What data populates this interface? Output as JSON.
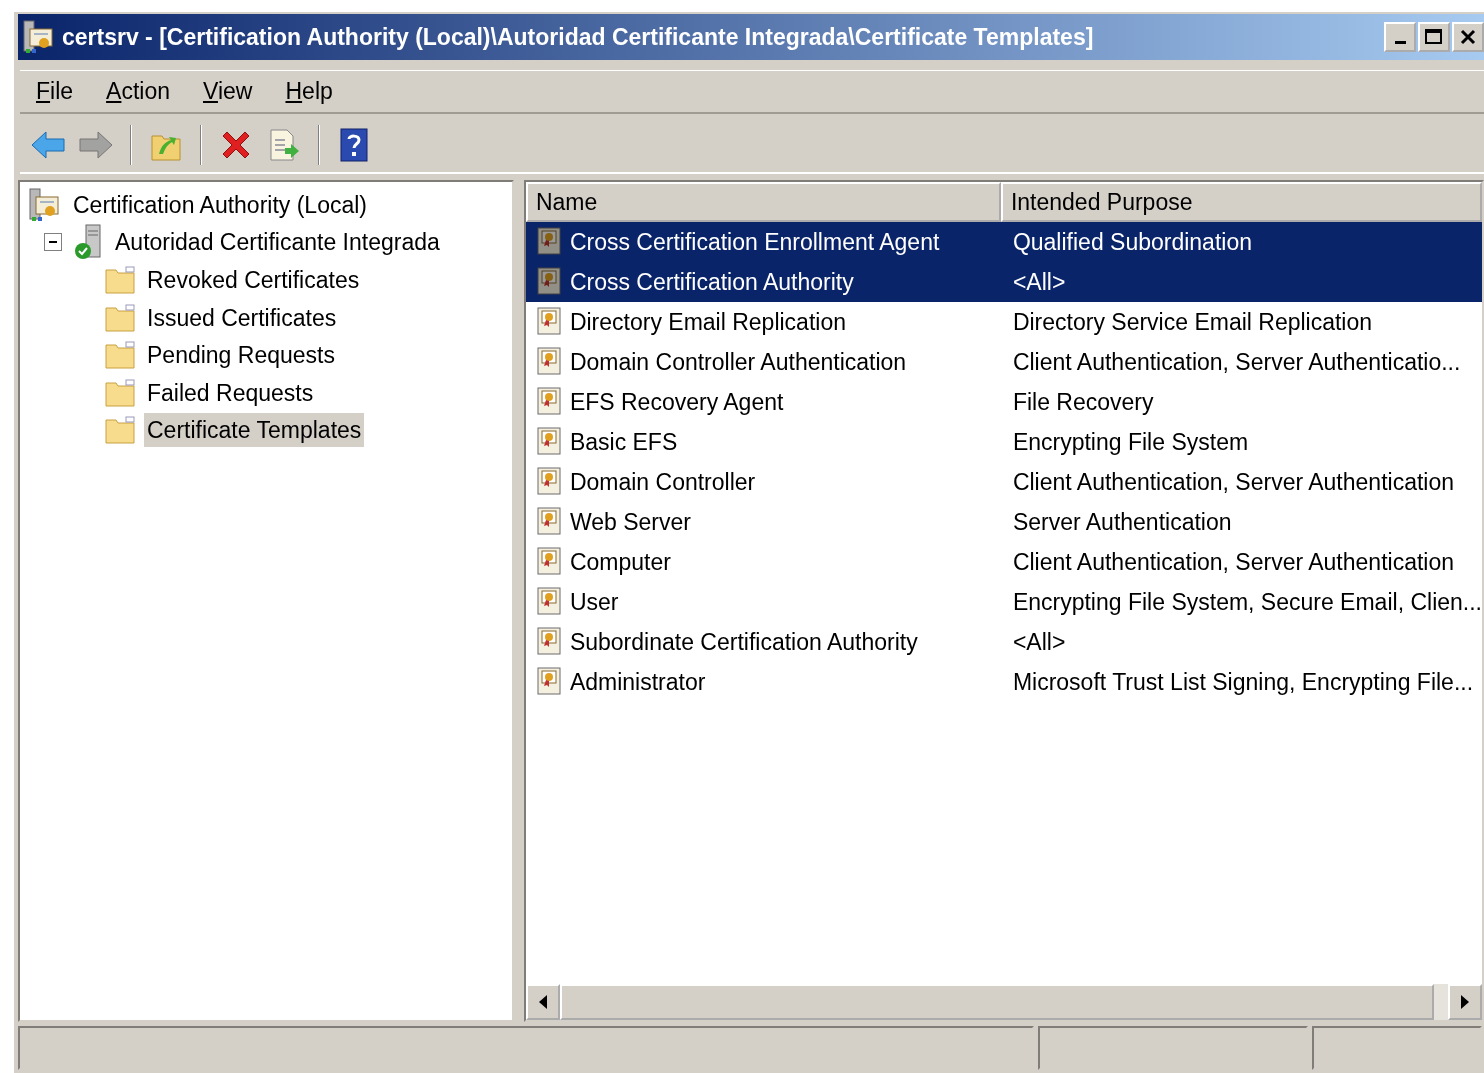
{
  "window": {
    "title": "certsrv - [Certification Authority (Local)\\Autoridad Certificante Integrada\\Certificate Templates]"
  },
  "menu": [
    {
      "label": "File"
    },
    {
      "label": "Action"
    },
    {
      "label": "View"
    },
    {
      "label": "Help"
    }
  ],
  "toolbar": [
    {
      "kind": "back",
      "disabled": false
    },
    {
      "kind": "forward",
      "disabled": true
    },
    {
      "kind": "separator"
    },
    {
      "kind": "up",
      "disabled": false
    },
    {
      "kind": "separator"
    },
    {
      "kind": "delete",
      "disabled": false
    },
    {
      "kind": "export",
      "disabled": false
    },
    {
      "kind": "separator"
    },
    {
      "kind": "help",
      "disabled": false
    }
  ],
  "tree": [
    {
      "label": "Certification Authority (Local)",
      "kind": "ca",
      "selected": false,
      "children": [
        {
          "label": "Autoridad Certificante Integrada",
          "kind": "server",
          "expanded": true,
          "selected": false,
          "children": [
            {
              "label": "Revoked Certificates",
              "kind": "folder",
              "selected": false
            },
            {
              "label": "Issued Certificates",
              "kind": "folder",
              "selected": false
            },
            {
              "label": "Pending Requests",
              "kind": "folder",
              "selected": false
            },
            {
              "label": "Failed Requests",
              "kind": "folder",
              "selected": false
            },
            {
              "label": "Certificate Templates",
              "kind": "folder",
              "selected": true
            }
          ]
        }
      ]
    }
  ],
  "table": {
    "columns": [
      "Name",
      "Intended Purpose"
    ],
    "rows": [
      {
        "name": "Cross Certification Enrollment Agent",
        "purpose": "Qualified Subordination",
        "selected": true
      },
      {
        "name": "Cross Certification Authority",
        "purpose": "<All>",
        "selected": true
      },
      {
        "name": "Directory Email Replication",
        "purpose": "Directory Service Email Replication",
        "selected": false
      },
      {
        "name": "Domain Controller Authentication",
        "purpose": "Client Authentication, Server Authenticatio...",
        "selected": false
      },
      {
        "name": "EFS Recovery Agent",
        "purpose": "File Recovery",
        "selected": false
      },
      {
        "name": "Basic EFS",
        "purpose": "Encrypting File System",
        "selected": false
      },
      {
        "name": "Domain Controller",
        "purpose": "Client Authentication, Server Authentication",
        "selected": false
      },
      {
        "name": "Web Server",
        "purpose": "Server Authentication",
        "selected": false
      },
      {
        "name": "Computer",
        "purpose": "Client Authentication, Server Authentication",
        "selected": false
      },
      {
        "name": "User",
        "purpose": "Encrypting File System, Secure Email, Clien...",
        "selected": false
      },
      {
        "name": "Subordinate Certification Authority",
        "purpose": "<All>",
        "selected": false
      },
      {
        "name": "Administrator",
        "purpose": "Microsoft Trust List Signing, Encrypting File...",
        "selected": false
      }
    ]
  }
}
